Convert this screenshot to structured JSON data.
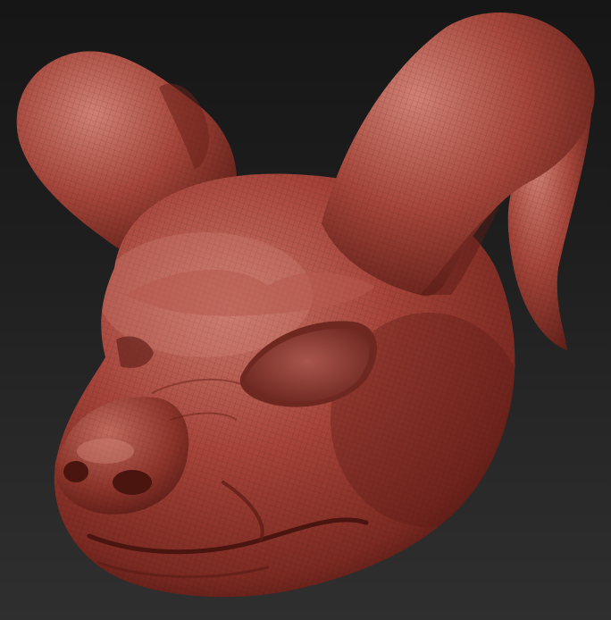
{
  "scene": {
    "background_top": "#161616",
    "background_bottom": "#2f2f2f",
    "clay_base": "#9c3b2f",
    "clay_highlight": "#c9776b",
    "clay_shadow": "#4e1711",
    "wireframe_color": "#3d0f0a"
  }
}
